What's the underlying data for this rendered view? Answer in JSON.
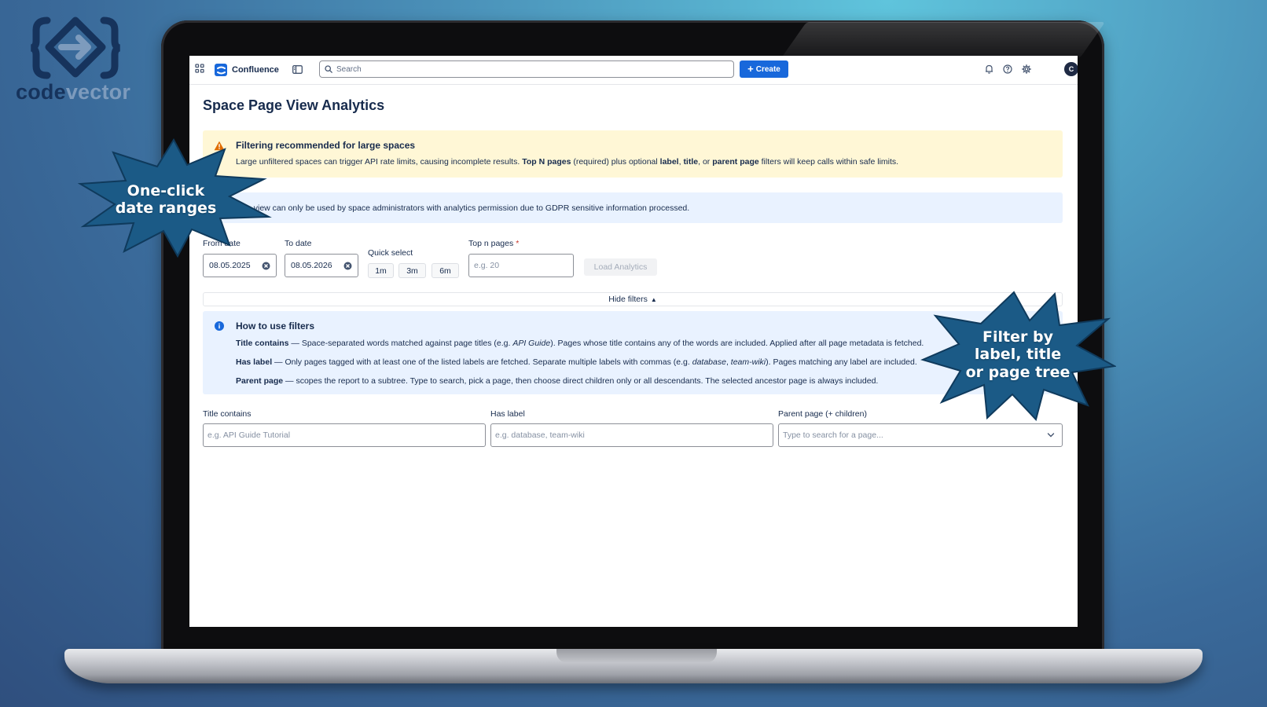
{
  "brand_logo": {
    "word_part1": "code",
    "word_part2": "vector",
    "icon": "code-arrow-logo-icon"
  },
  "callouts": {
    "date_ranges": {
      "line1": "One-click",
      "line2": "date ranges"
    },
    "filters": {
      "line1": "Filter by",
      "line2": "label, title",
      "line3": "or page tree"
    }
  },
  "topbar": {
    "app_name": "Confluence",
    "search_placeholder": "Search",
    "create_label": "Create",
    "avatar_initial": "C",
    "icons": [
      "apps-grid-icon",
      "sidebar-toggle-icon",
      "search-icon",
      "bell-icon",
      "help-icon",
      "gear-icon"
    ]
  },
  "page": {
    "title": "Space Page View Analytics",
    "warning": {
      "title": "Filtering recommended for large spaces",
      "text_part1": "Large unfiltered spaces can trigger API rate limits, causing incomplete results. ",
      "text_bold1": "Top N pages",
      "text_part2": " (required) plus optional ",
      "text_bold2": "label",
      "text_part3": ", ",
      "text_bold3": "title",
      "text_part4": ", or ",
      "text_bold4": "parent page",
      "text_part5": " filters will keep calls within safe limits."
    },
    "info": {
      "text": "This view can only be used by space administrators with analytics permission due to GDPR sensitive information processed."
    },
    "controls": {
      "from_date_label": "From date",
      "from_date_value": "08.05.2025",
      "to_date_label": "To date",
      "to_date_value": "08.05.2026",
      "quick_select_label": "Quick select",
      "quick_options": [
        "1m",
        "3m",
        "6m"
      ],
      "top_n_label": "Top n pages",
      "top_n_required": "*",
      "top_n_placeholder": "e.g. 20",
      "load_label": "Load Analytics"
    },
    "hide_filters_label": "Hide filters",
    "hide_filters_arrow": "▲",
    "howto": {
      "title": "How to use filters",
      "title_contains_term": "Title contains",
      "title_contains_desc1": " — Space-separated words matched against page titles (e.g. ",
      "title_contains_example": "API Guide",
      "title_contains_desc2": "). Pages whose title contains any of the words are included. Applied after all page metadata is fetched.",
      "has_label_term": "Has label",
      "has_label_desc1": " — Only pages tagged with at least one of the listed labels are fetched. Separate multiple labels with commas (e.g. ",
      "has_label_example1": "database",
      "has_label_sep": ", ",
      "has_label_example2": "team-wiki",
      "has_label_desc2": "). Pages matching any label are included.",
      "parent_page_term": "Parent page",
      "parent_page_desc": " — scopes the report to a subtree. Type to search, pick a page, then choose direct children only or all descendants. The selected ancestor page is always included."
    },
    "filters": {
      "title_label": "Title contains",
      "title_placeholder": "e.g. API Guide Tutorial",
      "label_label": "Has label",
      "label_placeholder": "e.g. database, team-wiki",
      "parent_label": "Parent page (+ children)",
      "parent_placeholder": "Type to search for a page..."
    }
  },
  "colors": {
    "accent": "#1868db",
    "warning_bg": "#fff7d6",
    "info_bg": "#e9f2ff",
    "callout_fill": "#1b5a86",
    "warning_icon": "#e06c00",
    "info_icon": "#1868db"
  }
}
